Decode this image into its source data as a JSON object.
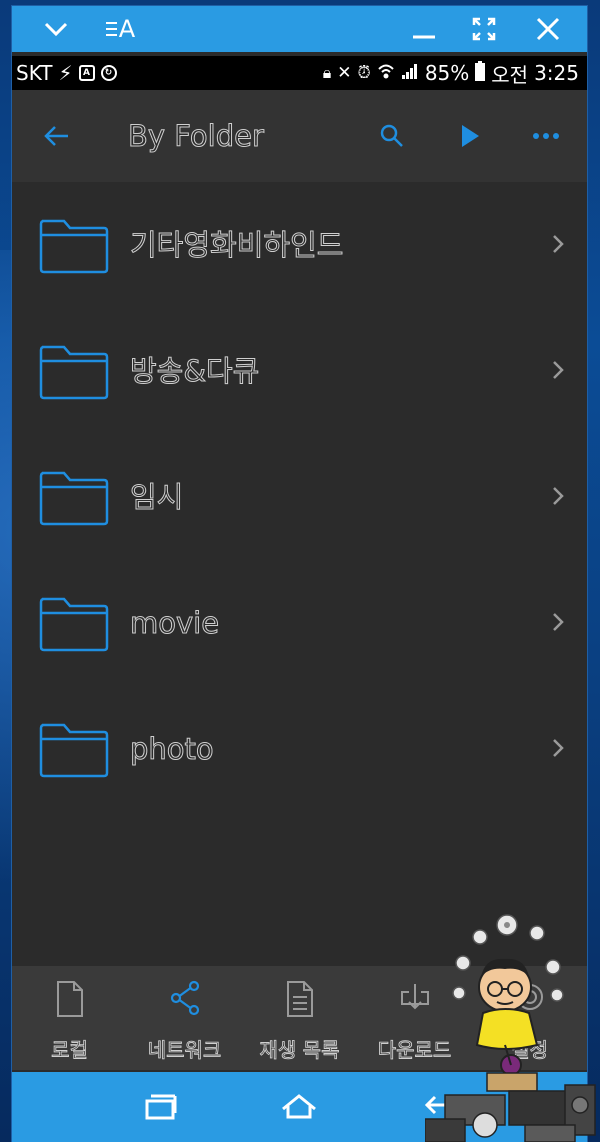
{
  "window": {
    "title_icon": "text-A-icon",
    "title_letter": "A",
    "buttons": [
      "chevron-down-icon",
      "minimize-icon",
      "fullscreen-icon",
      "close-icon"
    ]
  },
  "status_bar": {
    "carrier": "SKT",
    "battery_percent": "85%",
    "am_pm": "오전",
    "time": "3:25",
    "notification_box_label": "A"
  },
  "app_bar": {
    "title": "By Folder",
    "icons": [
      "back-arrow-icon",
      "search-icon",
      "play-icon",
      "more-icon"
    ]
  },
  "folders": [
    {
      "label": "기타영화비하인드"
    },
    {
      "label": "방송&다큐"
    },
    {
      "label": "임시"
    },
    {
      "label": "movie"
    },
    {
      "label": "photo"
    }
  ],
  "bottom_nav": [
    {
      "label": "로컬",
      "icon": "file-icon",
      "active": false
    },
    {
      "label": "네트워크",
      "icon": "share-icon",
      "active": true
    },
    {
      "label": "재생 목록",
      "icon": "document-icon",
      "active": false
    },
    {
      "label": "다운로드",
      "icon": "download-icon",
      "active": false
    },
    {
      "label": "설정",
      "icon": "settings-icon",
      "active": false
    }
  ],
  "colors": {
    "accent": "#2a9be3",
    "background": "#2b2b2b",
    "appbar": "#333333",
    "bottom_nav": "#3a3a3a",
    "icon_blue": "#1f8ee0"
  }
}
